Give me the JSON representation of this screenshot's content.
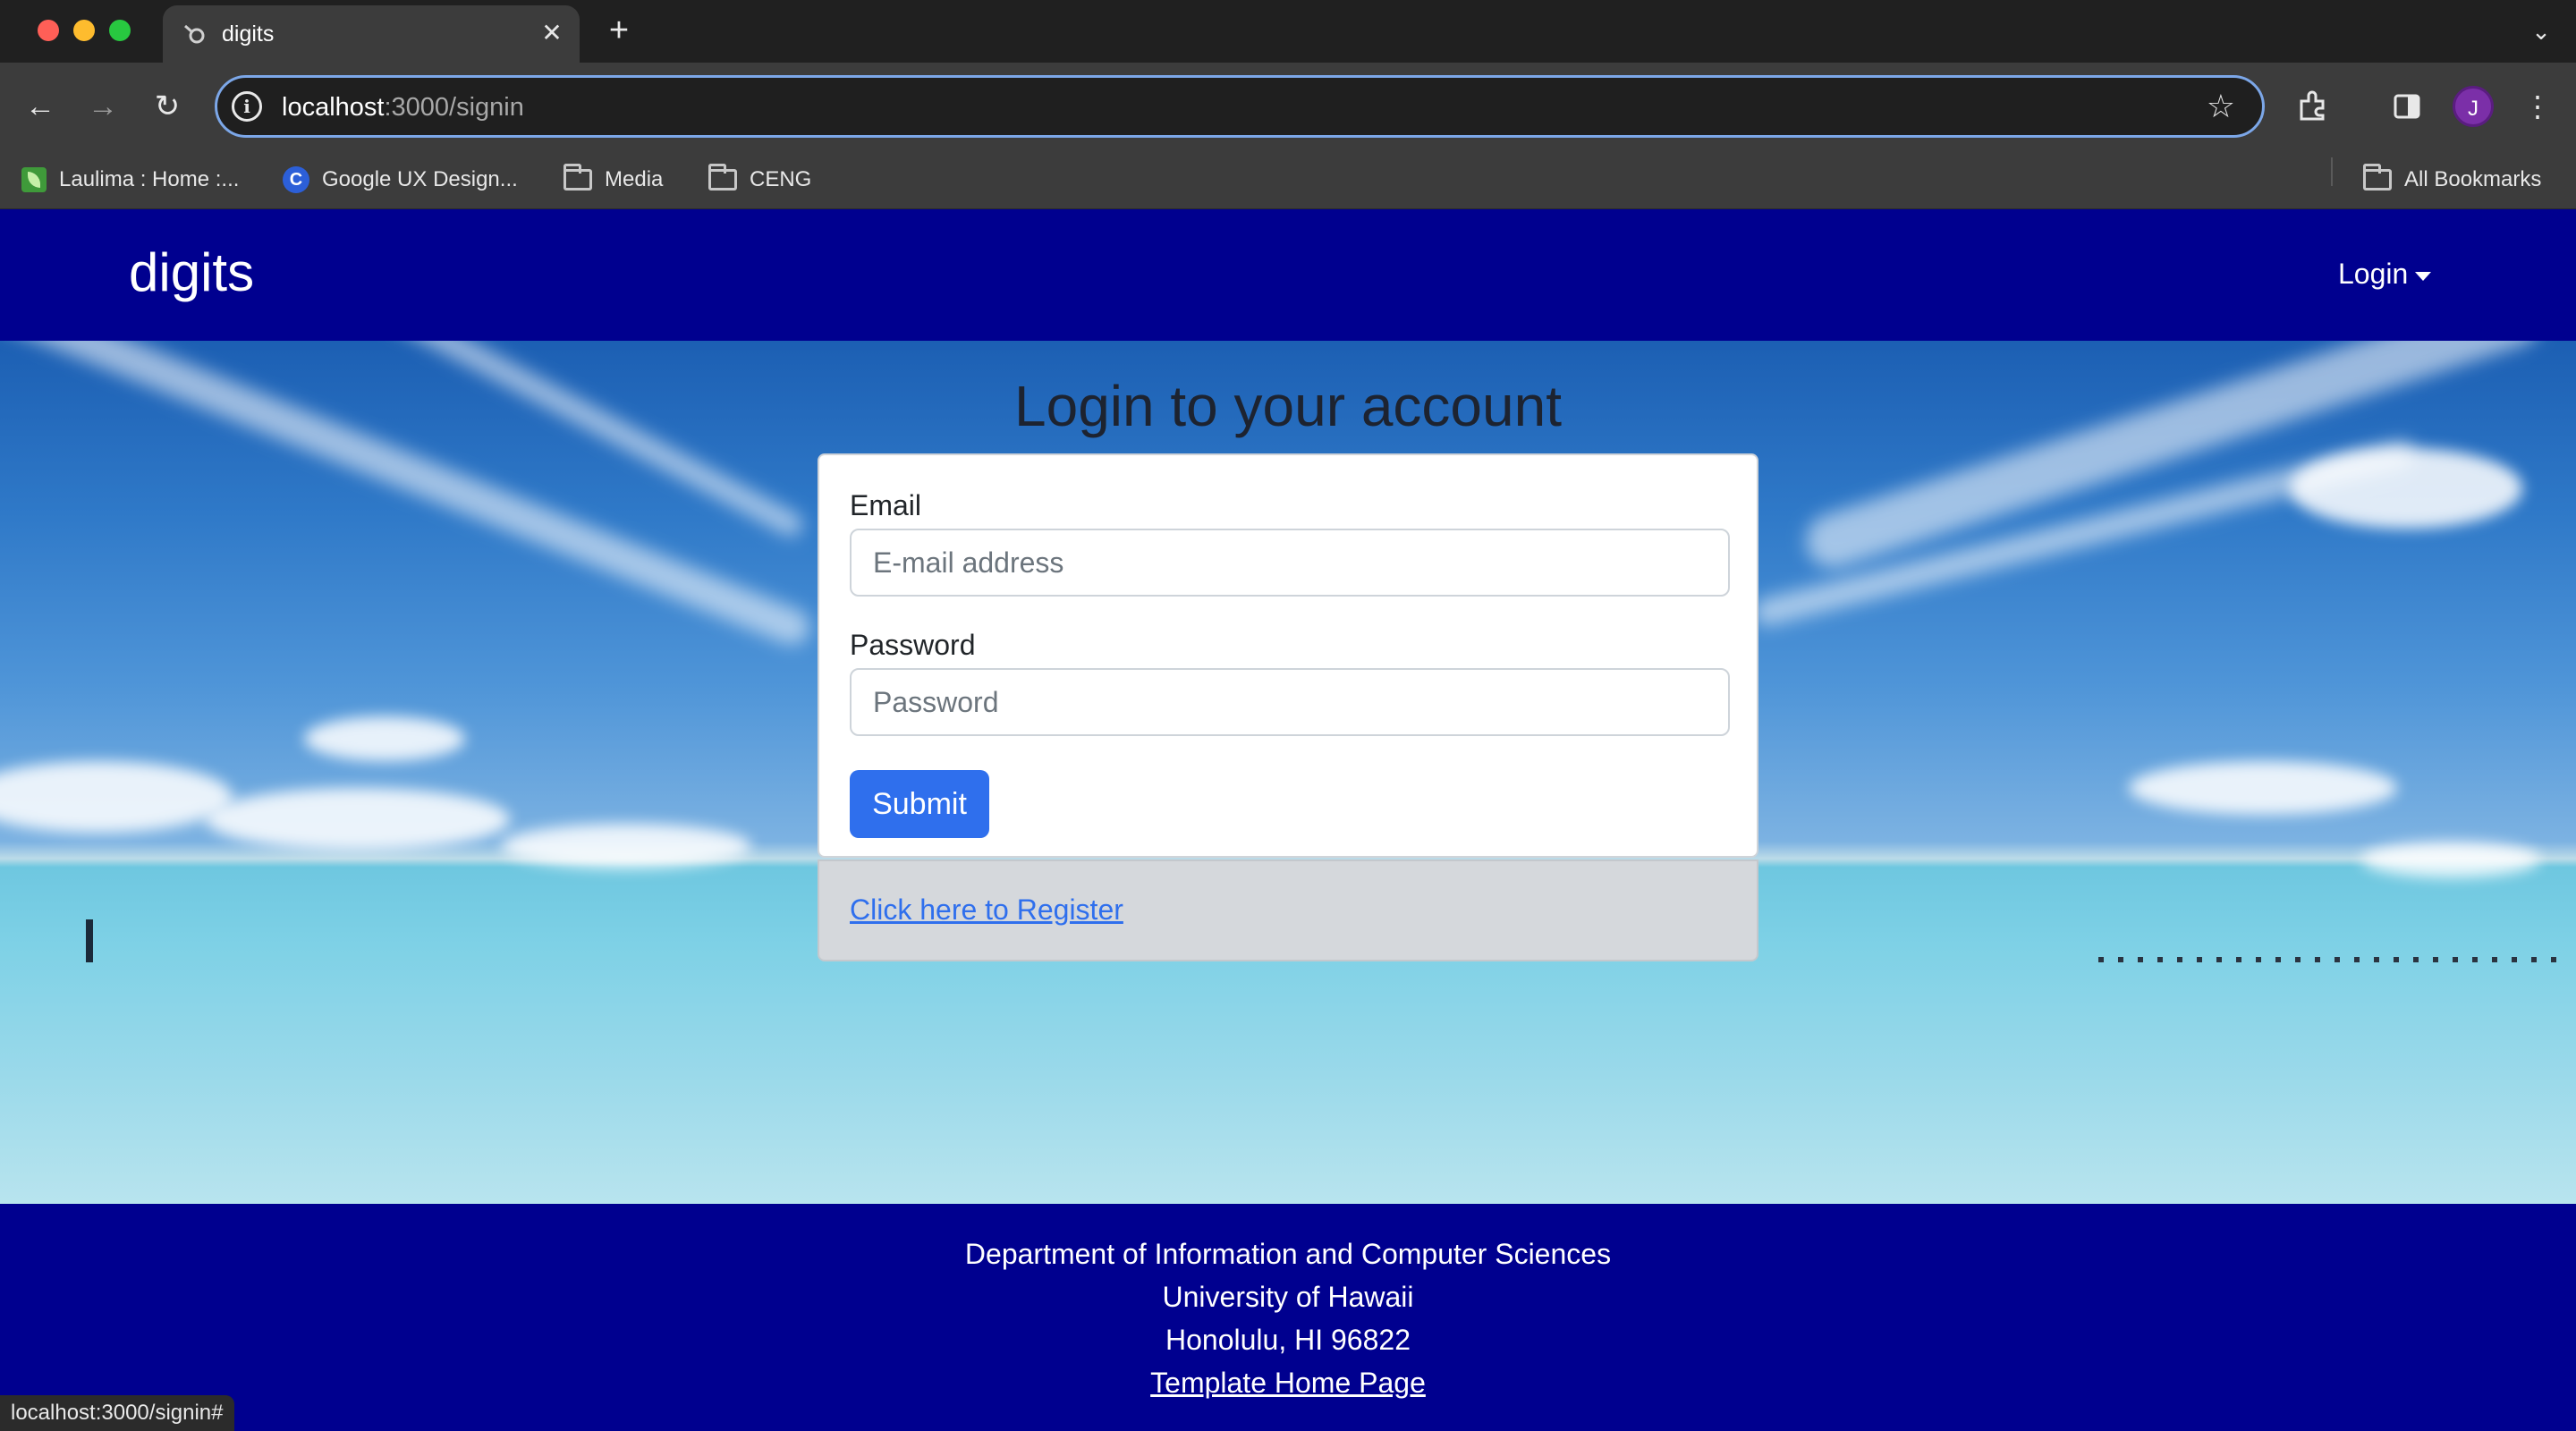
{
  "browser": {
    "tab_title": "digits",
    "url_host": "localhost",
    "url_path": ":3000/signin",
    "avatar_letter": "J",
    "bookmarks": [
      {
        "label": "Laulima : Home :...",
        "icon": "leaf-icon"
      },
      {
        "label": "Google UX Design...",
        "icon": "c-logo-icon"
      },
      {
        "label": "Media",
        "icon": "folder-icon"
      },
      {
        "label": "CENG",
        "icon": "folder-icon"
      }
    ],
    "all_bookmarks": "All Bookmarks",
    "status_url": "localhost:3000/signin#"
  },
  "navbar": {
    "brand": "digits",
    "login_menu": "Login"
  },
  "login": {
    "title": "Login to your account",
    "email_label": "Email",
    "email_placeholder": "E-mail address",
    "password_label": "Password",
    "password_placeholder": "Password",
    "submit_label": "Submit",
    "register_link": "Click here to Register"
  },
  "footer": {
    "line1": "Department of Information and Computer Sciences",
    "line2": "University of Hawaii",
    "line3": "Honolulu, HI 96822",
    "link": "Template Home Page"
  },
  "colors": {
    "navbar": "#00008f",
    "button": "#2f6fed",
    "link": "#2f6fed"
  }
}
